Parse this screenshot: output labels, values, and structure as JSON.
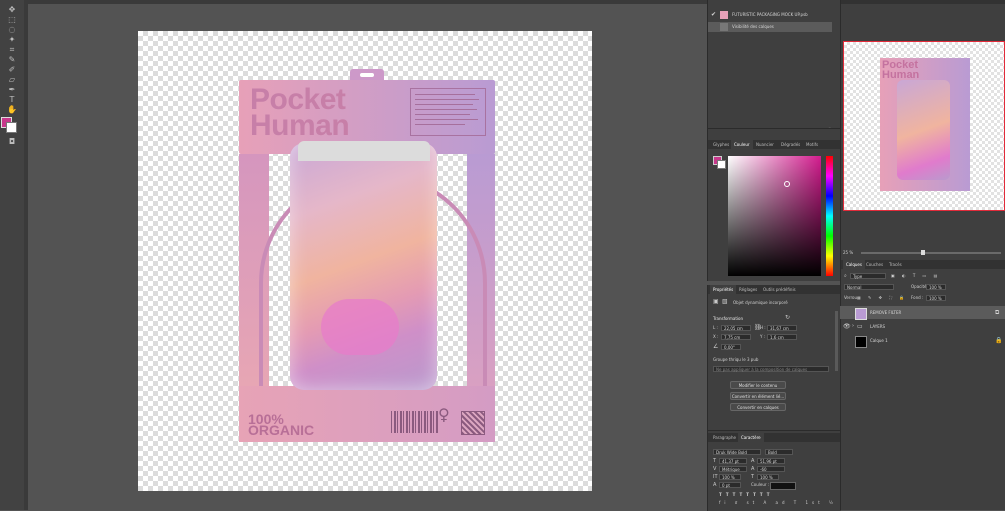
{
  "colors": {
    "foreground": "#c7378b",
    "background": "#ffffff",
    "accent": "#d31c8e"
  },
  "toolbar": {
    "tools": [
      "move-icon",
      "marquee-icon",
      "lasso-icon",
      "wand-icon",
      "crop-icon",
      "eyedropper-icon",
      "heal-icon",
      "brush-icon",
      "stamp-icon",
      "history-brush-icon",
      "eraser-icon",
      "gradient-icon",
      "blur-icon",
      "dodge-icon",
      "pen-icon",
      "type-icon",
      "path-select-icon",
      "shape-icon",
      "hand-icon",
      "zoom-icon"
    ]
  },
  "artwork": {
    "title_line1": "Pocket",
    "title_line2": "Human",
    "organic_line1": "100%",
    "organic_line2": "ORGANIC"
  },
  "history": {
    "snapshot": "FUTURISTIC PACKAGING MOCK UP.psb",
    "step": "Visibilité des calques"
  },
  "color_panel": {
    "tabs": [
      "Glyphes",
      "Couleur",
      "Nuancier",
      "Dégradés",
      "Motifs"
    ],
    "active_tab": "Couleur"
  },
  "properties": {
    "tabs": [
      "Propriétés",
      "Réglages",
      "Outils prédéfinis"
    ],
    "active_tab": "Propriétés",
    "object_type": "Objet dynamique incorporé",
    "section_transform": "Transformation",
    "w_label": "L :",
    "w_value": "22,05 cm",
    "h_label": "H :",
    "h_value": "31,67 cm",
    "x_label": "X :",
    "x_value": "7,75 cm",
    "y_label": "Y :",
    "y_value": "1,6 cm",
    "angle_value": "0,00°",
    "comp_label": "Groupe thriqu le 3 pub",
    "comp_field": "Ne pas appliquer à la composition de calques",
    "btn_edit": "Modifier le contenu",
    "btn_convert_linked": "Convertir en élément lié...",
    "btn_convert_layers": "Convertir en calques"
  },
  "character": {
    "tabs": [
      "Paragraphe",
      "Caractère"
    ],
    "active_tab": "Caractère",
    "font_family": "Druk Wide Bold",
    "font_style": "Bold",
    "size": "41,37 pt",
    "leading": "51,96 pt",
    "kerning": "Métrique",
    "tracking": "-60",
    "vscale": "100 %",
    "hscale": "100 %",
    "baseline": "0 pt",
    "color_label": "Couleur :"
  },
  "navigator": {
    "zoom": "25 %"
  },
  "layers_panel": {
    "tabs": [
      "Calques",
      "Couches",
      "Tracés"
    ],
    "active_tab": "Calques",
    "filter_kind": "Type",
    "blend_mode": "Normal",
    "opacity_label": "Opacité :",
    "opacity_value": "100 %",
    "lock_label": "Verrou :",
    "fill_label": "Fond :",
    "fill_value": "100 %",
    "layers": [
      {
        "name": "REMOVE FILTER",
        "type": "smart-object",
        "visible": true
      },
      {
        "name": "LAYERS",
        "type": "group",
        "visible": true
      },
      {
        "name": "Calque 1",
        "type": "pixel",
        "visible": false,
        "locked": true
      }
    ]
  }
}
